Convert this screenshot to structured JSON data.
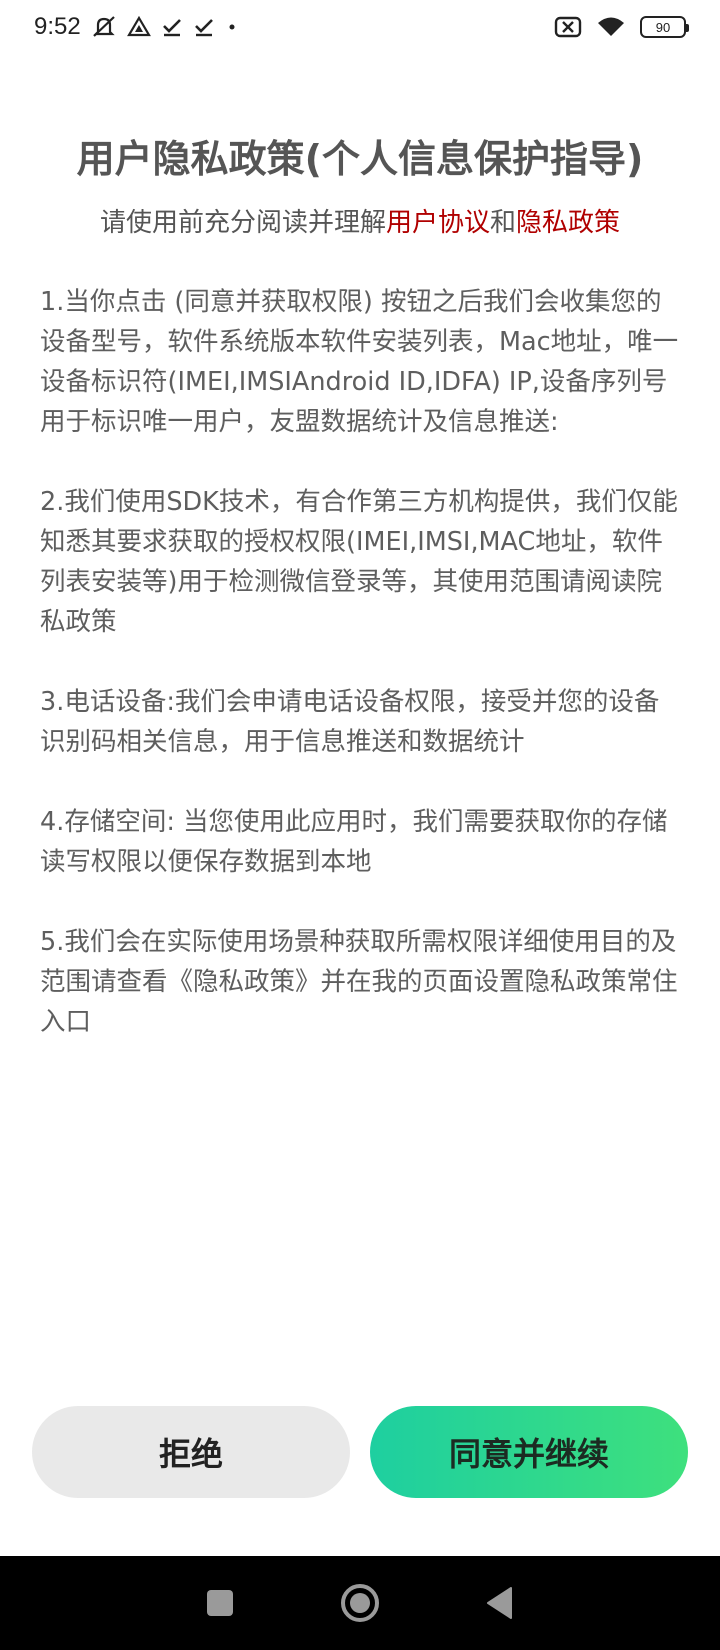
{
  "status_bar": {
    "time": "9:52",
    "battery": "90",
    "icons": [
      "bell-muted-icon",
      "drive-icon",
      "check-icon",
      "check-icon",
      "dot-icon",
      "sim-off-icon",
      "wifi-icon",
      "battery-icon"
    ]
  },
  "title": "用户隐私政策(个人信息保护指导)",
  "subtitle": {
    "prefix": "请使用前充分阅读并理解",
    "link1": "用户协议",
    "middle": "和",
    "link2": "隐私政策",
    "link_color": "#b00000"
  },
  "paragraphs": [
    "1.当你点击 (同意并获取权限) 按钮之后我们会收集您的设备型号，软件系统版本软件安装列表，Mac地址，唯一设备标识符(IMEI,IMSIAndroid ID,IDFA) IP,设备序列号用于标识唯一用户，友盟数据统计及信息推送:",
    "2.我们使用SDK技术，有合作第三方机构提供，我们仅能知悉其要求获取的授权权限(IMEI,IMSI,MAC地址，软件列表安装等)用于检测微信登录等，其使用范围请阅读院私政策",
    "3.电话设备:我们会申请电话设备权限，接受并您的设备识别码相关信息，用于信息推送和数据统计",
    "4.存储空间: 当您使用此应用时，我们需要获取你的存储读写权限以便保存数据到本地",
    "5.我们会在实际使用场景种获取所需权限详细使用目的及范围请查看《隐私政策》并在我的页面设置隐私政策常住入口"
  ],
  "buttons": {
    "reject": "拒绝",
    "agree": "同意并继续"
  },
  "colors": {
    "agree_start": "#1ecfa0",
    "agree_end": "#3ee07d",
    "reject_bg": "#e9e9e9"
  }
}
